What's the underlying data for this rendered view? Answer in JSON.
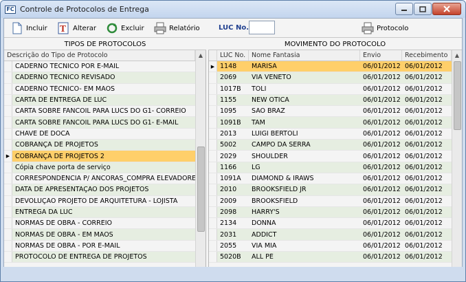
{
  "window": {
    "title": "Controle de Protocolos de Entrega",
    "icon_text": "FC"
  },
  "toolbar": {
    "incluir": "Incluir",
    "alterar": "Alterar",
    "excluir": "Excluir",
    "relatorio": "Relatório",
    "luc_label": "LUC No.:",
    "luc_value": "",
    "protocolo": "Protocolo"
  },
  "left_panel": {
    "title": "TIPOS DE PROTOCOLOS",
    "column": "Descrição do Tipo de Protocolo",
    "selected_index": 8,
    "items": [
      "CADERNO TÉCNICO POR E-MAIL",
      "CADERNO TÉCNICO REVISADO",
      "CADERNO TÉCNICO- EM MÃOS",
      "CARTA DE ENTREGA DE LUC",
      "CARTA SOBRE FANCOIL PARA LUCS DO G1- CORREIO",
      "CARTA SOBRE FANCOIL PARA LUCS DO G1- E-MAIL",
      "CHAVE DE DOCA",
      "COBRANÇA DE PROJETOS",
      "COBRANÇA DE PROJETOS 2",
      "Cópia chave porta de serviço",
      "CORRESPONDÊNCIA P/ ÂNCORAS_COMPRA ELEVADORES",
      "DATA DE APRESENTAÇÃO DOS PROJETOS",
      "DEVOLUÇÃO PROJETO DE ARQUITETURA - LOJISTA",
      "ENTREGA DA LUC",
      "NORMAS DE OBRA - CORREIO",
      "NORMAS DE OBRA - EM MÃOS",
      "NORMAS DE OBRA - POR E-MAIL",
      "PROTOCOLO DE ENTREGA DE PROJETOS"
    ]
  },
  "right_panel": {
    "title": "MOVIMENTO DO PROTOCOLO",
    "columns": [
      "LUC No.",
      "Nome Fantasia",
      "Envio",
      "Recebimento"
    ],
    "selected_index": 0,
    "rows": [
      [
        "1148",
        "MARISA",
        "06/01/2012",
        "06/01/2012"
      ],
      [
        "2069",
        "VIA VENETO",
        "06/01/2012",
        "06/01/2012"
      ],
      [
        "1017B",
        "TOLI",
        "06/01/2012",
        "06/01/2012"
      ],
      [
        "1155",
        "NEW ÓTICA",
        "06/01/2012",
        "06/01/2012"
      ],
      [
        "1095",
        "SÃO BRAZ",
        "06/01/2012",
        "06/01/2012"
      ],
      [
        "1091B",
        "TAM",
        "06/01/2012",
        "06/01/2012"
      ],
      [
        "2013",
        "LUIGI BERTOLI",
        "06/01/2012",
        "06/01/2012"
      ],
      [
        "5002",
        "CAMPO DA SERRA",
        "06/01/2012",
        "06/01/2012"
      ],
      [
        "2029",
        "SHOULDER",
        "06/01/2012",
        "06/01/2012"
      ],
      [
        "1166",
        "LG",
        "06/01/2012",
        "06/01/2012"
      ],
      [
        "1091A",
        "DIAMOND & IRAWS",
        "06/01/2012",
        "06/01/2012"
      ],
      [
        "2010",
        "BROOKSFIELD JR",
        "06/01/2012",
        "06/01/2012"
      ],
      [
        "2009",
        "BROOKSFIELD",
        "06/01/2012",
        "06/01/2012"
      ],
      [
        "2098",
        "HARRY'S",
        "06/01/2012",
        "06/01/2012"
      ],
      [
        "2134",
        "DONNA",
        "06/01/2012",
        "06/01/2012"
      ],
      [
        "2031",
        "ADDICT",
        "06/01/2012",
        "06/01/2012"
      ],
      [
        "2055",
        "VIA MIA",
        "06/01/2012",
        "06/01/2012"
      ],
      [
        "5020B",
        "ALL PÉ",
        "06/01/2012",
        "06/01/2012"
      ]
    ]
  },
  "colors": {
    "selected_row": "#ffcf6a",
    "alt_row": "#e6eee1",
    "frame": "#cfdcee"
  }
}
